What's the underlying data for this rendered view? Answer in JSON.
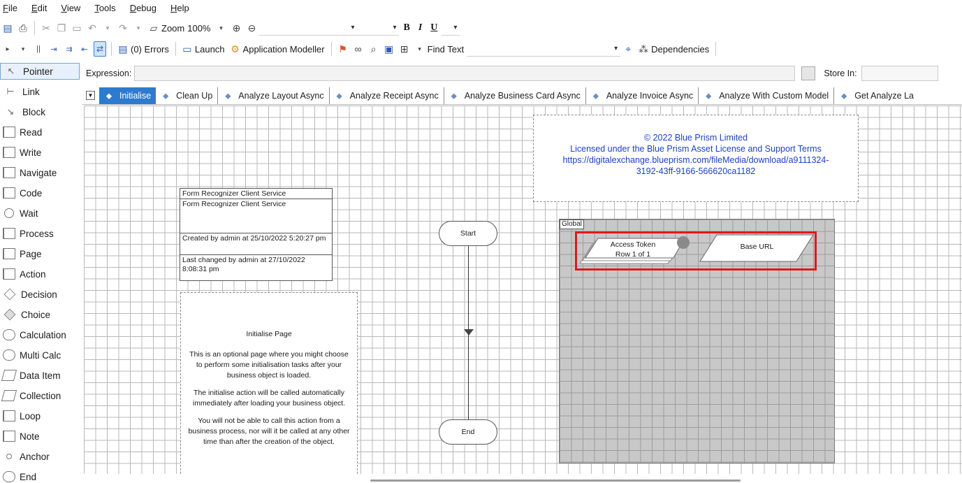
{
  "menubar": {
    "items": [
      {
        "label": "File",
        "ul": "F"
      },
      {
        "label": "Edit",
        "ul": "E"
      },
      {
        "label": "View",
        "ul": "V"
      },
      {
        "label": "Tools",
        "ul": "T"
      },
      {
        "label": "Debug",
        "ul": "D"
      },
      {
        "label": "Help",
        "ul": "H"
      }
    ]
  },
  "toolbar1": {
    "zoom_label": "Zoom",
    "zoom_value": "100%",
    "bold": "B",
    "italic": "I",
    "underline": "U"
  },
  "toolbar2": {
    "errors_label": "(0) Errors",
    "launch_label": "Launch",
    "app_modeller_label": "Application Modeller",
    "find_text_label": "Find Text",
    "dependencies_label": "Dependencies"
  },
  "palette": {
    "items": [
      "Pointer",
      "Link",
      "Block",
      "Read",
      "Write",
      "Navigate",
      "Code",
      "Wait",
      "Process",
      "Page",
      "Action",
      "Decision",
      "Choice",
      "Calculation",
      "Multi Calc",
      "Data Item",
      "Collection",
      "Loop",
      "Note",
      "Anchor",
      "End"
    ]
  },
  "expression": {
    "label": "Expression:",
    "value": "",
    "store_label": "Store In:",
    "store_value": ""
  },
  "tabs": [
    "Initialise",
    "Clean Up",
    "Analyze Layout Async",
    "Analyze Receipt Async",
    "Analyze Business Card Async",
    "Analyze Invoice Async",
    "Analyze With Custom Model",
    "Get Analyze La"
  ],
  "info_box": {
    "title": "Form Recognizer Client Service",
    "name": "Form Recognizer Client Service",
    "created": "Created by admin at 25/10/2022 5:20:27 pm",
    "changed": "Last changed by admin at 27/10/2022 8:08:31 pm"
  },
  "init_note": {
    "title": "Initialise Page",
    "p1": "This is an optional page where you might choose to perform some initialisation tasks after your business object is loaded.",
    "p2": "The initialise action will be called automatically immediately after loading your business object.",
    "p3": "You will not be able to call this action from a business process, nor will it be called at any other time than after the creation of the object."
  },
  "copyright_note": {
    "line1": "© 2022 Blue Prism Limited",
    "line2": "Licensed under the Blue Prism Asset License and Support Terms",
    "line3": "https://digitalexchange.blueprism.com/fileMedia/download/a9111324-",
    "line4": "3192-43ff-9166-566620ca1182"
  },
  "flow": {
    "start_label": "Start",
    "end_label": "End"
  },
  "global_block": {
    "label": "Global",
    "items": [
      {
        "name": "Access Token",
        "subtitle": "Row 1 of 1"
      },
      {
        "name": "Base URL"
      }
    ]
  },
  "colors": {
    "tab_active": "#2d7bd0",
    "note_text": "#1a3fd0",
    "highlight": "#e0191c",
    "block_fill": "#c8c8c8"
  }
}
